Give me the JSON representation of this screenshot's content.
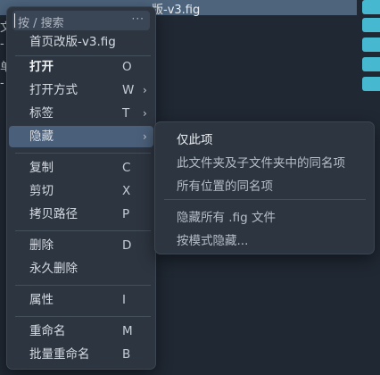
{
  "background": {
    "selected_file": "版-v3.fig",
    "fragments": [
      "文",
      "-",
      "单",
      "-"
    ],
    "accent_color": "#46b8cf"
  },
  "context_menu": {
    "search_placeholder": "按 / 搜索",
    "more_icon": "···",
    "current_file": "首页改版-v3.fig",
    "items": [
      {
        "label": "打开",
        "key": "O"
      },
      {
        "label": "打开方式",
        "key": "W",
        "arrow": "›"
      },
      {
        "label": "标签",
        "key": "T",
        "arrow": "›"
      },
      {
        "label": "隐藏",
        "key": "",
        "arrow": "›"
      },
      {
        "label": "复制",
        "key": "C"
      },
      {
        "label": "剪切",
        "key": "X"
      },
      {
        "label": "拷贝路径",
        "key": "P"
      },
      {
        "label": "删除",
        "key": "D"
      },
      {
        "label": "永久删除",
        "key": ""
      },
      {
        "label": "属性",
        "key": "I"
      },
      {
        "label": "重命名",
        "key": "M"
      },
      {
        "label": "批量重命名",
        "key": "B"
      }
    ]
  },
  "hide_submenu": {
    "items": [
      {
        "label": "仅此项"
      },
      {
        "label": "此文件夹及子文件夹中的同名项"
      },
      {
        "label": "所有位置的同名项"
      },
      {
        "label": "隐藏所有 .fig 文件"
      },
      {
        "label": "按模式隐藏..."
      }
    ]
  }
}
